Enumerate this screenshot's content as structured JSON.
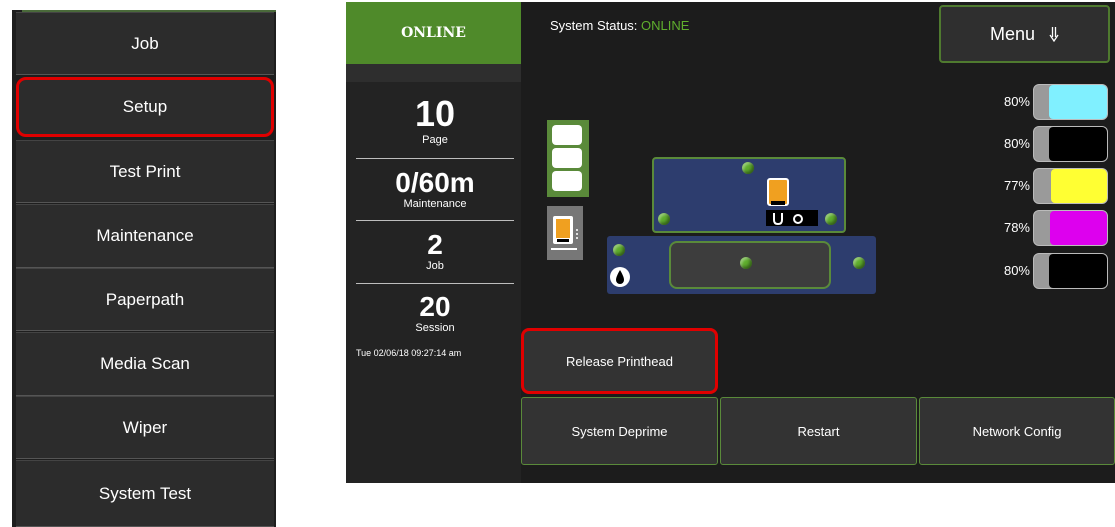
{
  "left_menu": {
    "items": [
      {
        "label": "Job",
        "selected": false
      },
      {
        "label": "Setup",
        "selected": true
      },
      {
        "label": "Test Print",
        "selected": false
      },
      {
        "label": "Maintenance",
        "selected": false
      },
      {
        "label": "Paperpath",
        "selected": false
      },
      {
        "label": "Media Scan",
        "selected": false
      },
      {
        "label": "Wiper",
        "selected": false
      },
      {
        "label": "System Test",
        "selected": false
      }
    ]
  },
  "panel": {
    "online_label": "ONLINE",
    "status_label": "System Status:",
    "status_value": "ONLINE",
    "menu_label": "Menu",
    "menu_icon": "arrow-down-icon",
    "counters": [
      {
        "value": "10",
        "label": "Page"
      },
      {
        "value": "0/60m",
        "label": "Maintenance"
      },
      {
        "value": "2",
        "label": "Job"
      },
      {
        "value": "20",
        "label": "Session"
      }
    ],
    "datetime": "Tue 02/06/18 09:27:14 am",
    "inks": [
      {
        "percent": "80%",
        "color": "#80f0ff",
        "level": 0.8
      },
      {
        "percent": "80%",
        "color": "#000000",
        "level": 0.8
      },
      {
        "percent": "77%",
        "color": "#ffff33",
        "level": 0.77
      },
      {
        "percent": "78%",
        "color": "#dd00ee",
        "level": 0.78
      },
      {
        "percent": "80%",
        "color": "#000000",
        "level": 0.8
      }
    ],
    "buttons": {
      "release_printhead": "Release Printhead",
      "system_deprime": "System Deprime",
      "restart": "Restart",
      "network_config": "Network Config"
    },
    "colors": {
      "accent_green": "#4f8a2a",
      "status_green": "#5fae2d",
      "selection_red": "#e00000",
      "head_blue": "#2d3d6e",
      "cartridge_orange": "#f0a020"
    }
  }
}
